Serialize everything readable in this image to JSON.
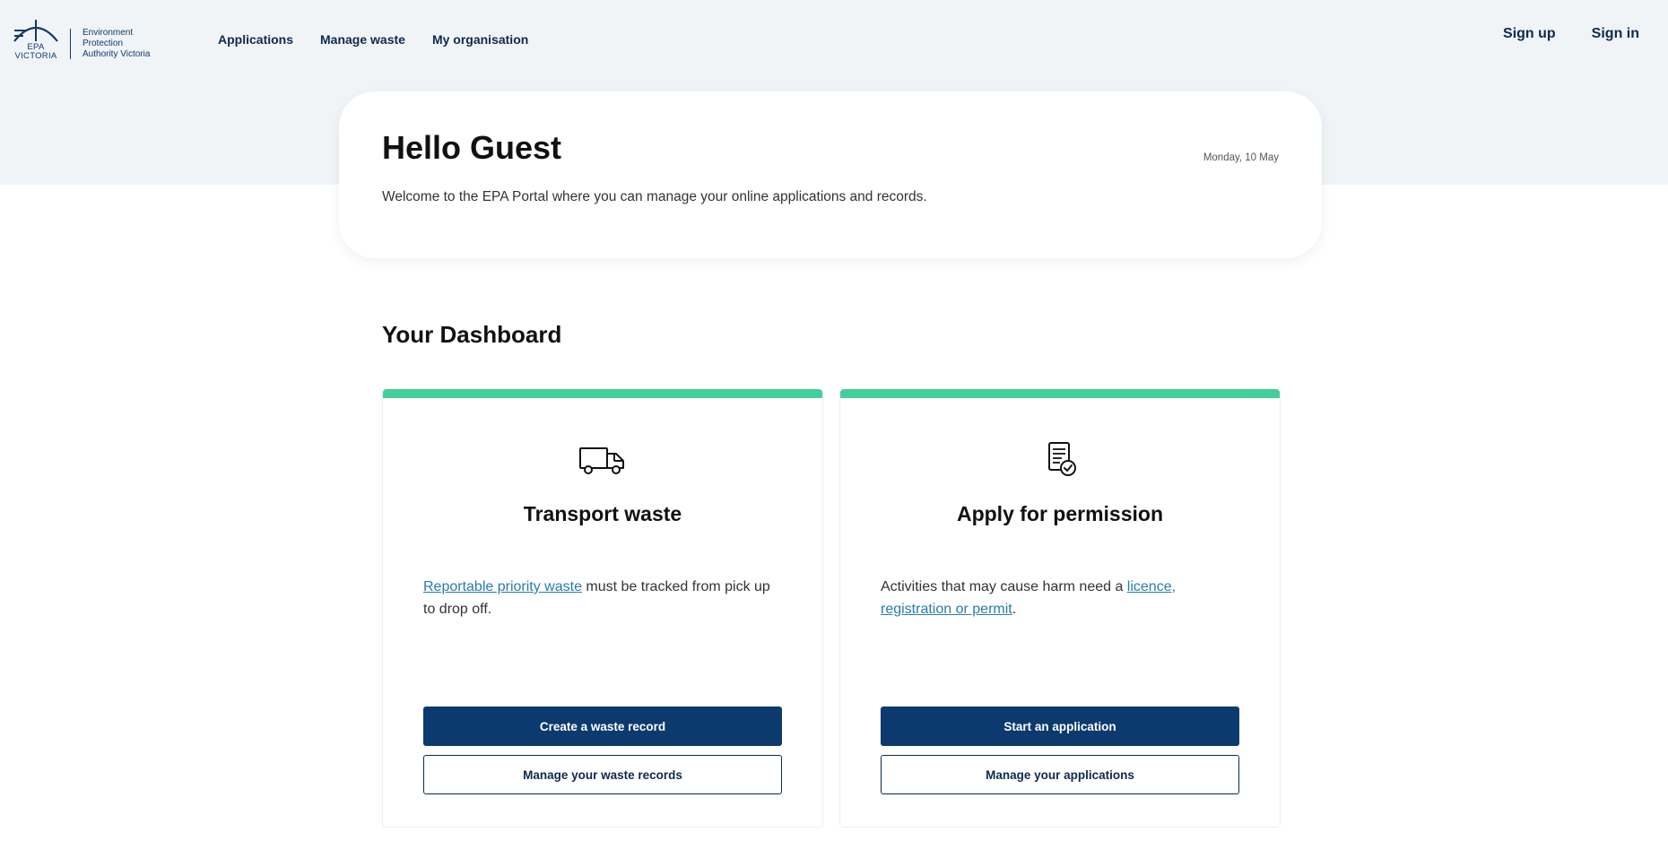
{
  "header": {
    "logo": {
      "abbr_line1": "EPA",
      "abbr_line2": "VICTORIA",
      "name_line1": "Environment",
      "name_line2": "Protection",
      "name_line3": "Authority Victoria"
    },
    "nav": [
      {
        "label": "Applications"
      },
      {
        "label": "Manage waste"
      },
      {
        "label": "My organisation"
      }
    ],
    "auth": {
      "signup": "Sign up",
      "signin": "Sign in"
    }
  },
  "greeting": {
    "title": "Hello Guest",
    "date": "Monday, 10 May",
    "subtitle": "Welcome to the EPA Portal where you can manage your online applications and records."
  },
  "dashboard": {
    "title": "Your Dashboard",
    "cards": [
      {
        "icon": "truck-icon",
        "title": "Transport waste",
        "link_text": "Reportable priority waste",
        "text_after": " must be tracked from pick up to drop off.",
        "primary_button": "Create a waste record",
        "secondary_button": "Manage your waste records"
      },
      {
        "icon": "document-check-icon",
        "title": "Apply for permission",
        "text_before": "Activities that may cause harm need a ",
        "link_text": "licence, registration or permit",
        "text_after": ".",
        "primary_button": "Start an application",
        "secondary_button": "Manage your applications"
      }
    ]
  },
  "colors": {
    "brand_navy": "#0d3a6e",
    "accent_green": "#44cf9a",
    "link_blue": "#2a7bab",
    "hero_bg": "#f1f4f7"
  }
}
